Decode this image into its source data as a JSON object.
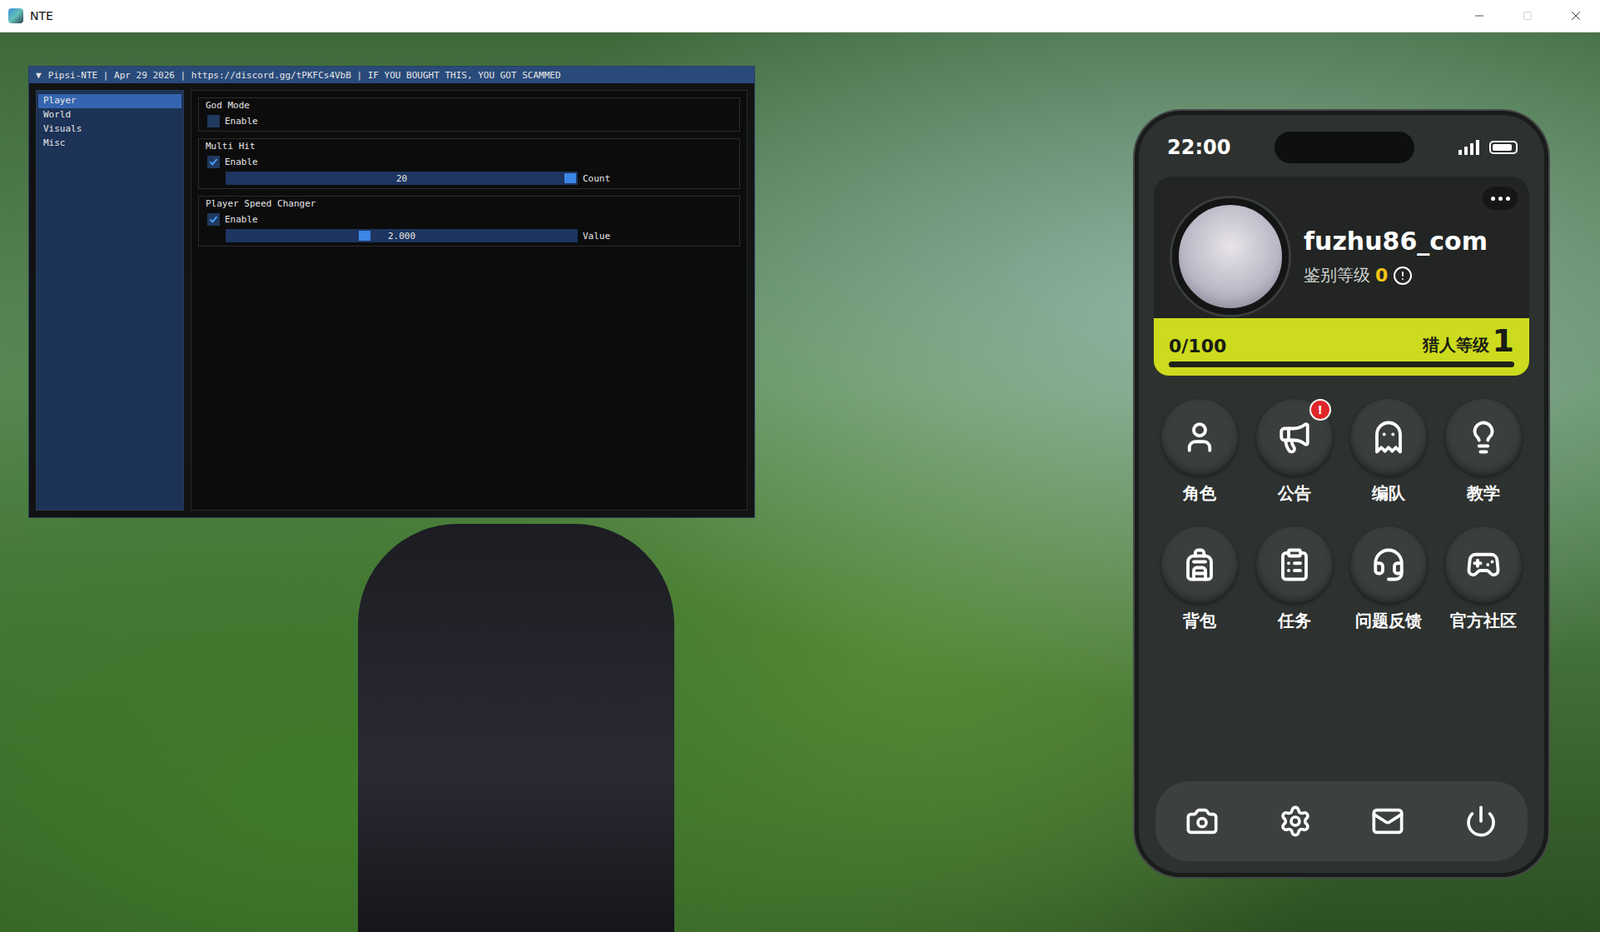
{
  "window": {
    "title": "NTE"
  },
  "cheat_menu": {
    "collapse_glyph": "▼",
    "title": "Pipsi-NTE | Apr 29 2026 | https://discord.gg/tPKFCs4VbB | IF YOU BOUGHT THIS, YOU GOT SCAMMED",
    "tabs": [
      {
        "label": "Player",
        "selected": true
      },
      {
        "label": "World",
        "selected": false
      },
      {
        "label": "Visuals",
        "selected": false
      },
      {
        "label": "Misc",
        "selected": false
      }
    ],
    "groups": [
      {
        "title": "God Mode",
        "controls": [
          {
            "kind": "checkbox",
            "label": "Enable",
            "checked": false
          }
        ]
      },
      {
        "title": "Multi Hit",
        "controls": [
          {
            "kind": "checkbox",
            "label": "Enable",
            "checked": true
          },
          {
            "kind": "slider",
            "value": "20",
            "label": "Count",
            "level": 1
          }
        ]
      },
      {
        "title": "Player Speed Changer",
        "controls": [
          {
            "kind": "checkbox",
            "label": "Enable",
            "checked": true
          },
          {
            "kind": "slider",
            "value": "2.000",
            "label": "Value",
            "level": 0.39
          }
        ]
      }
    ]
  },
  "phone": {
    "time": "22:00",
    "battery": {
      "level": 0.9
    },
    "profile": {
      "name": "fuzhu86_com",
      "rank_label": "鉴别等级",
      "rank_value": "0",
      "exp": "0/100",
      "hunter_label": "猎人等级",
      "hunter_level": "1",
      "exp_level": 0
    },
    "apps": [
      {
        "label": "角色"
      },
      {
        "label": "公告",
        "badge": "!"
      },
      {
        "label": "编队"
      },
      {
        "label": "教学"
      },
      {
        "label": "背包"
      },
      {
        "label": "任务"
      },
      {
        "label": "问题反馈"
      },
      {
        "label": "官方社区"
      }
    ]
  }
}
